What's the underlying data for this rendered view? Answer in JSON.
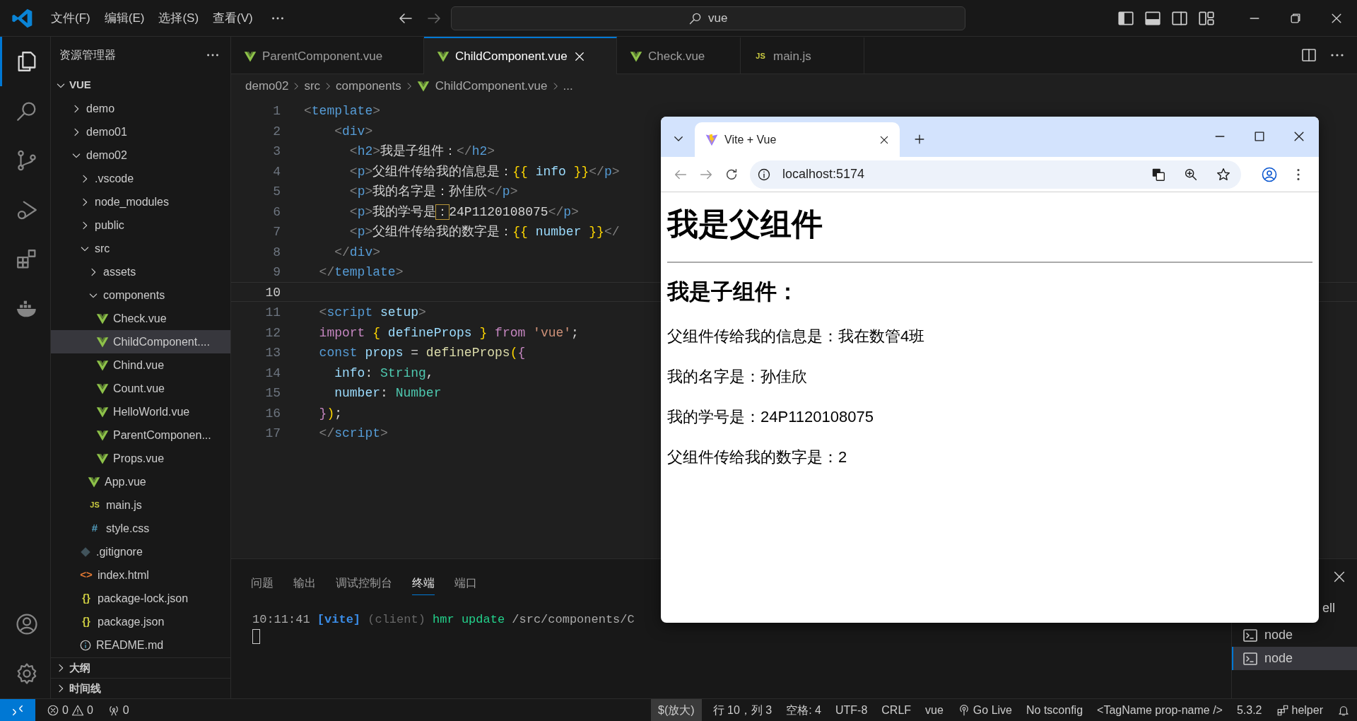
{
  "title_bar": {
    "menus": [
      "文件(F)",
      "编辑(E)",
      "选择(S)",
      "查看(V)"
    ],
    "search": {
      "value": "vue"
    }
  },
  "activity_bar": {
    "items": [
      {
        "kind": "explorer",
        "selected": true
      },
      {
        "kind": "search",
        "selected": false
      },
      {
        "kind": "source-control",
        "selected": false
      },
      {
        "kind": "run-debug",
        "selected": false
      },
      {
        "kind": "extensions",
        "selected": false
      },
      {
        "kind": "docker",
        "selected": false
      }
    ],
    "bottom": [
      {
        "kind": "account"
      },
      {
        "kind": "settings"
      }
    ]
  },
  "sidebar": {
    "title": "资源管理器",
    "tree": {
      "label": "VUE",
      "expanded": true,
      "children": [
        {
          "label": "demo",
          "kind": "folder",
          "expanded": false,
          "selected": false
        },
        {
          "label": "demo01",
          "kind": "folder",
          "expanded": false,
          "selected": false
        },
        {
          "label": "demo02",
          "kind": "folder",
          "expanded": true,
          "selected": false,
          "children": [
            {
              "label": ".vscode",
              "kind": "folder",
              "expanded": false,
              "selected": false
            },
            {
              "label": "node_modules",
              "kind": "folder",
              "expanded": false,
              "selected": false
            },
            {
              "label": "public",
              "kind": "folder",
              "expanded": false,
              "selected": false
            },
            {
              "label": "src",
              "kind": "folder",
              "expanded": true,
              "selected": false,
              "children": [
                {
                  "label": "assets",
                  "kind": "folder",
                  "expanded": false,
                  "selected": false
                },
                {
                  "label": "components",
                  "kind": "folder",
                  "expanded": true,
                  "selected": false,
                  "children": [
                    {
                      "label": "Check.vue",
                      "kind": "vue",
                      "selected": false
                    },
                    {
                      "label": "ChildComponent....",
                      "kind": "vue",
                      "selected": true
                    },
                    {
                      "label": "Chind.vue",
                      "kind": "vue",
                      "selected": false
                    },
                    {
                      "label": "Count.vue",
                      "kind": "vue",
                      "selected": false
                    },
                    {
                      "label": "HelloWorld.vue",
                      "kind": "vue",
                      "selected": false
                    },
                    {
                      "label": "ParentComponen...",
                      "kind": "vue",
                      "selected": false
                    },
                    {
                      "label": "Props.vue",
                      "kind": "vue",
                      "selected": false
                    }
                  ]
                },
                {
                  "label": "App.vue",
                  "kind": "vue",
                  "selected": false
                },
                {
                  "label": "main.js",
                  "kind": "js",
                  "icon_text": "JS",
                  "selected": false
                },
                {
                  "label": "style.css",
                  "kind": "css",
                  "icon_text": "#",
                  "selected": false
                }
              ]
            },
            {
              "label": ".gitignore",
              "kind": "git",
              "selected": false
            },
            {
              "label": "index.html",
              "kind": "html",
              "icon_text": "<>",
              "selected": false
            },
            {
              "label": "package-lock.json",
              "kind": "json",
              "icon_text": "{}",
              "selected": false
            },
            {
              "label": "package.json",
              "kind": "json",
              "icon_text": "{}",
              "selected": false
            },
            {
              "label": "README.md",
              "kind": "info",
              "selected": false
            }
          ]
        }
      ]
    },
    "sections": [
      {
        "label": "大纲",
        "expanded": false
      },
      {
        "label": "时间线",
        "expanded": false
      }
    ]
  },
  "editor_tabs": [
    {
      "label": "ParentComponent.vue",
      "kind": "vue",
      "selected": false
    },
    {
      "label": "ChildComponent.vue",
      "kind": "vue",
      "selected": true
    },
    {
      "label": "Check.vue",
      "kind": "vue",
      "selected": false
    },
    {
      "label": "main.js",
      "kind": "js",
      "icon_text": "JS",
      "selected": false
    }
  ],
  "breadcrumb": [
    {
      "label": "demo02"
    },
    {
      "label": "src"
    },
    {
      "label": "components"
    },
    {
      "label": "ChildComponent.vue",
      "kind": "vue"
    },
    {
      "label": "..."
    }
  ],
  "editor": {
    "lines": [
      {
        "number": "1",
        "current": false,
        "tokens": [
          {
            "text": "<",
            "kind": "punct"
          },
          {
            "text": "template",
            "kind": "tag"
          },
          {
            "text": ">",
            "kind": "punct"
          }
        ]
      },
      {
        "number": "2",
        "current": false,
        "tokens": [
          {
            "text": "    <",
            "kind": "punct"
          },
          {
            "text": "div",
            "kind": "tag"
          },
          {
            "text": ">",
            "kind": "punct"
          }
        ]
      },
      {
        "number": "3",
        "current": false,
        "tokens": [
          {
            "text": "      <",
            "kind": "punct"
          },
          {
            "text": "h2",
            "kind": "tag"
          },
          {
            "text": ">",
            "kind": "punct"
          },
          {
            "text": "我是子组件：",
            "kind": "text"
          },
          {
            "text": "</",
            "kind": "punct"
          },
          {
            "text": "h2",
            "kind": "tag"
          },
          {
            "text": ">",
            "kind": "punct"
          }
        ]
      },
      {
        "number": "4",
        "current": false,
        "tokens": [
          {
            "text": "      <",
            "kind": "punct"
          },
          {
            "text": "p",
            "kind": "tag"
          },
          {
            "text": ">",
            "kind": "punct"
          },
          {
            "text": "父组件传给我的信息是：",
            "kind": "text"
          },
          {
            "text": "{{",
            "kind": "brace"
          },
          {
            "text": " info ",
            "kind": "var"
          },
          {
            "text": "}}",
            "kind": "brace"
          },
          {
            "text": "</",
            "kind": "punct"
          },
          {
            "text": "p",
            "kind": "tag"
          },
          {
            "text": ">",
            "kind": "punct"
          }
        ]
      },
      {
        "number": "5",
        "current": false,
        "tokens": [
          {
            "text": "      <",
            "kind": "punct"
          },
          {
            "text": "p",
            "kind": "tag"
          },
          {
            "text": ">",
            "kind": "punct"
          },
          {
            "text": "我的名字是：孙佳欣",
            "kind": "text"
          },
          {
            "text": "</",
            "kind": "punct"
          },
          {
            "text": "p",
            "kind": "tag"
          },
          {
            "text": ">",
            "kind": "punct"
          }
        ]
      },
      {
        "number": "6",
        "current": false,
        "tokens": [
          {
            "text": "      <",
            "kind": "punct"
          },
          {
            "text": "p",
            "kind": "tag"
          },
          {
            "text": ">",
            "kind": "punct"
          },
          {
            "text": "我的学号是",
            "kind": "text"
          },
          {
            "text": "：",
            "kind": "match"
          },
          {
            "text": "24P1120108075",
            "kind": "text"
          },
          {
            "text": "</",
            "kind": "punct"
          },
          {
            "text": "p",
            "kind": "tag"
          },
          {
            "text": ">",
            "kind": "punct"
          }
        ]
      },
      {
        "number": "7",
        "current": false,
        "tokens": [
          {
            "text": "      <",
            "kind": "punct"
          },
          {
            "text": "p",
            "kind": "tag"
          },
          {
            "text": ">",
            "kind": "punct"
          },
          {
            "text": "父组件传给我的数字是：",
            "kind": "text"
          },
          {
            "text": "{{",
            "kind": "brace"
          },
          {
            "text": " number ",
            "kind": "var"
          },
          {
            "text": "}}",
            "kind": "brace"
          },
          {
            "text": "</",
            "kind": "punct"
          }
        ]
      },
      {
        "number": "8",
        "current": false,
        "tokens": [
          {
            "text": "    </",
            "kind": "punct"
          },
          {
            "text": "div",
            "kind": "tag"
          },
          {
            "text": ">",
            "kind": "punct"
          }
        ]
      },
      {
        "number": "9",
        "current": false,
        "tokens": [
          {
            "text": "  </",
            "kind": "punct"
          },
          {
            "text": "template",
            "kind": "tag"
          },
          {
            "text": ">",
            "kind": "punct"
          }
        ]
      },
      {
        "number": "10",
        "current": true
      },
      {
        "number": "11",
        "current": false,
        "tokens": [
          {
            "text": "  <",
            "kind": "punct"
          },
          {
            "text": "script",
            "kind": "tag"
          },
          {
            "text": " setup",
            "kind": "var"
          },
          {
            "text": ">",
            "kind": "punct"
          }
        ]
      },
      {
        "number": "12",
        "current": false,
        "tokens": [
          {
            "text": "  import ",
            "kind": "keyword"
          },
          {
            "text": "{",
            "kind": "brace"
          },
          {
            "text": " defineProps ",
            "kind": "var"
          },
          {
            "text": "}",
            "kind": "brace"
          },
          {
            "text": " from ",
            "kind": "keyword"
          },
          {
            "text": "'vue'",
            "kind": "string"
          },
          {
            "text": ";",
            "kind": "text"
          }
        ]
      },
      {
        "number": "13",
        "current": false,
        "tokens": [
          {
            "text": "  const ",
            "kind": "storage"
          },
          {
            "text": "props",
            "kind": "var"
          },
          {
            "text": " = ",
            "kind": "text"
          },
          {
            "text": "defineProps",
            "kind": "func"
          },
          {
            "text": "(",
            "kind": "brace"
          },
          {
            "text": "{",
            "kind": "keyword"
          }
        ]
      },
      {
        "number": "14",
        "current": false,
        "tokens": [
          {
            "text": "    info",
            "kind": "var"
          },
          {
            "text": ": ",
            "kind": "text"
          },
          {
            "text": "String",
            "kind": "type"
          },
          {
            "text": ",",
            "kind": "text"
          }
        ]
      },
      {
        "number": "15",
        "current": false,
        "tokens": [
          {
            "text": "    number",
            "kind": "var"
          },
          {
            "text": ": ",
            "kind": "text"
          },
          {
            "text": "Number",
            "kind": "type"
          }
        ]
      },
      {
        "number": "16",
        "current": false,
        "tokens": [
          {
            "text": "  }",
            "kind": "keyword"
          },
          {
            "text": ")",
            "kind": "brace"
          },
          {
            "text": ";",
            "kind": "text"
          }
        ]
      },
      {
        "number": "17",
        "current": false,
        "tokens": [
          {
            "text": "  </",
            "kind": "punct"
          },
          {
            "text": "script",
            "kind": "tag"
          },
          {
            "text": ">",
            "kind": "punct"
          }
        ]
      }
    ]
  },
  "panel": {
    "tabs": [
      {
        "label": "问题",
        "selected": false
      },
      {
        "label": "输出",
        "selected": false
      },
      {
        "label": "调试控制台",
        "selected": false
      },
      {
        "label": "终端",
        "selected": true
      },
      {
        "label": "端口",
        "selected": false
      }
    ],
    "terminal": [
      {
        "text": "10:11:41 ",
        "kind": "time"
      },
      {
        "text": "[vite] ",
        "kind": "info"
      },
      {
        "text": "(client) ",
        "kind": "dim"
      },
      {
        "text": "hmr update ",
        "kind": "ok"
      },
      {
        "text": "/src/components/C",
        "kind": "path"
      }
    ],
    "terminal_list": [
      {
        "label": "ell",
        "clipped": true,
        "selected": false
      },
      {
        "label": "node",
        "clipped": false,
        "selected": false
      },
      {
        "label": "node",
        "clipped": false,
        "selected": true
      }
    ]
  },
  "status_bar": {
    "errors": "0",
    "warnings": "0",
    "ports": "0",
    "items": [
      {
        "text": "$(放大)",
        "kind": "highlight"
      },
      {
        "text": "行 10，列 3",
        "kind": "plain"
      },
      {
        "text": "空格: 4",
        "kind": "plain"
      },
      {
        "text": "UTF-8",
        "kind": "plain"
      },
      {
        "text": "CRLF",
        "kind": "plain"
      },
      {
        "text": "vue",
        "kind": "plain"
      },
      {
        "text": "Go Live",
        "kind": "broadcast"
      },
      {
        "text": "No tsconfig",
        "kind": "plain"
      },
      {
        "text": "<TagName prop-name />",
        "kind": "plain"
      },
      {
        "text": "5.3.2",
        "kind": "plain"
      },
      {
        "text": "helper",
        "kind": "extension"
      },
      {
        "kind": "bell"
      }
    ]
  },
  "browser": {
    "tab": {
      "title": "Vite + Vue"
    },
    "url": "localhost:5174",
    "page": [
      {
        "kind": "h1",
        "text": "我是父组件"
      },
      {
        "kind": "hr"
      },
      {
        "kind": "h2",
        "text": "我是子组件："
      },
      {
        "kind": "p",
        "text": "父组件传给我的信息是：我在数管4班"
      },
      {
        "kind": "p",
        "text": "我的名字是：孙佳欣"
      },
      {
        "kind": "p",
        "text": "我的学号是：24P1120108075"
      },
      {
        "kind": "p",
        "text": "父组件传给我的数字是：2"
      }
    ]
  }
}
